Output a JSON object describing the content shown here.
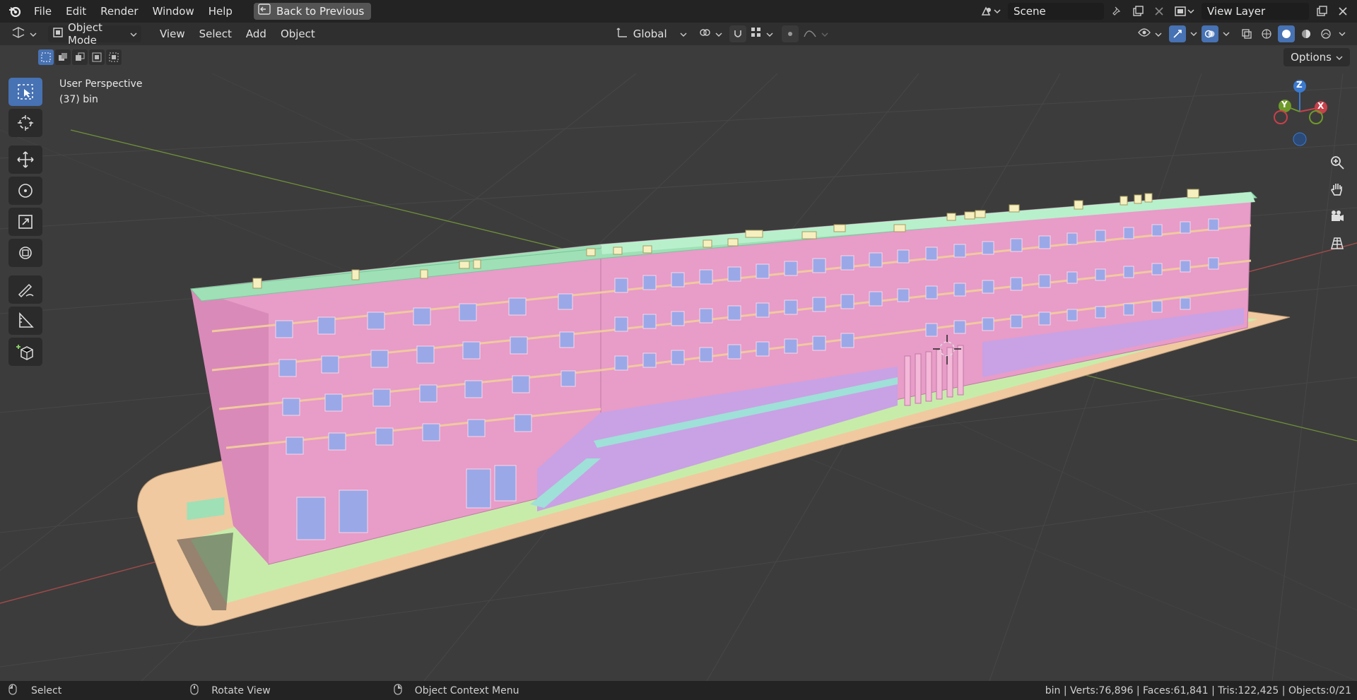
{
  "menu": {
    "file": "File",
    "edit": "Edit",
    "render": "Render",
    "window": "Window",
    "help": "Help",
    "back_to_previous": "Back to Previous"
  },
  "scene": {
    "name": "Scene"
  },
  "view_layer": {
    "name": "View Layer"
  },
  "header": {
    "mode": "Object Mode",
    "view": "View",
    "select": "Select",
    "add": "Add",
    "object": "Object",
    "orientation": "Global"
  },
  "options_label": "Options",
  "viewport": {
    "perspective": "User Perspective",
    "object_info": "(37) bin"
  },
  "gizmo": {
    "x": "X",
    "y": "Y",
    "z": "Z"
  },
  "status": {
    "select": "Select",
    "rotate": "Rotate View",
    "context_menu": "Object Context Menu",
    "stats": "bin | Verts:76,896 | Faces:61,841 | Tris:122,425 | Objects:0/21"
  },
  "colors": {
    "accent": "#4772b3",
    "facade": "#e89cc8",
    "roof": "#9fe0b6",
    "ground": "#f0c9a0",
    "lawn": "#c7ecaa",
    "window": "#9aa8e8",
    "lower_floor": "#c8a2e4"
  }
}
